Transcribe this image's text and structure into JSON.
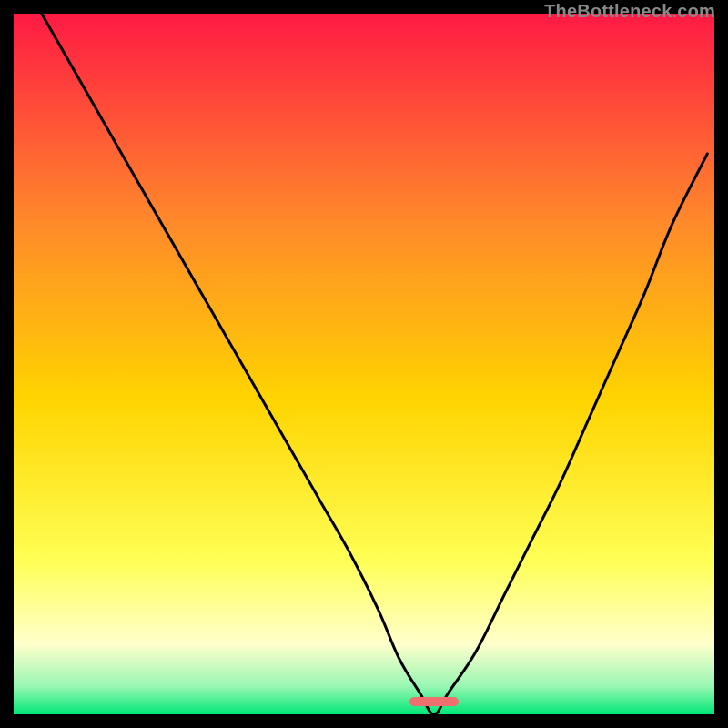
{
  "watermark": "TheBottleneck.com",
  "gradient_colors": {
    "top": "#ff1a44",
    "upper_mid": "#ff8a2a",
    "mid": "#ffd400",
    "lower_mid": "#ffff55",
    "pale": "#ffffcc",
    "green_light": "#98f7b3",
    "green": "#00e676"
  },
  "marker": {
    "left_pct": 56.5,
    "width_pct": 7.0,
    "bottom_pct": 1.2,
    "color": "#ef6f6f"
  },
  "chart_data": {
    "type": "line",
    "title": "",
    "xlabel": "",
    "ylabel": "",
    "xlim": [
      0,
      100
    ],
    "ylim": [
      0,
      100
    ],
    "series": [
      {
        "name": "bottleneck-curve",
        "x": [
          4,
          8,
          12,
          16,
          20,
          24,
          28,
          32,
          36,
          40,
          44,
          48,
          52,
          55,
          58,
          60,
          62,
          66,
          70,
          74,
          78,
          82,
          86,
          90,
          94,
          99
        ],
        "y": [
          100,
          93,
          86,
          79,
          72,
          65,
          58,
          51,
          44,
          37,
          30,
          23,
          15,
          8,
          3,
          0,
          3,
          9,
          17,
          25,
          33,
          42,
          51,
          60,
          70,
          80
        ]
      }
    ],
    "minimum_x": 60,
    "note": "V-shaped bottleneck curve on vertical red→yellow→green gradient; minimum near x≈60. Values estimated from pixels; no axis ticks shown."
  }
}
